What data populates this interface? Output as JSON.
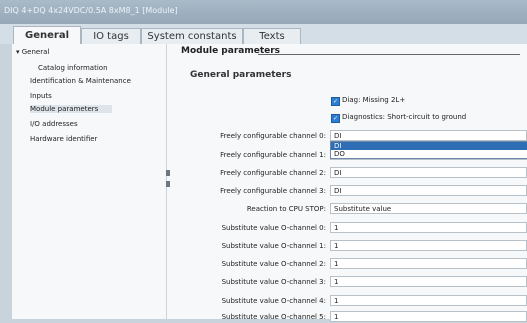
{
  "window": {
    "title": "DIQ 4+DQ 4x24VDC/0.5A 8xM8_1 [Module]"
  },
  "tabs": [
    {
      "label": "General",
      "active": true
    },
    {
      "label": "IO tags",
      "active": false
    },
    {
      "label": "System constants",
      "active": false
    },
    {
      "label": "Texts",
      "active": false
    }
  ],
  "nav": {
    "general": "▾ General",
    "catalog": "Catalog information",
    "identification": "Identification & Maintenance",
    "inputs": "Inputs",
    "module_parameters": "Module parameters",
    "io_addresses": "I/O addresses",
    "hardware_identifier": "Hardware identifier"
  },
  "main": {
    "section_title": "Module parameters",
    "subsection_title": "General parameters",
    "checks": [
      {
        "label": "Diag: Missing 2L+",
        "checked": true
      },
      {
        "label": "Diagnostics: Short-circuit to ground",
        "checked": true
      }
    ],
    "rows": [
      {
        "label": "Freely configurable channel 0:",
        "value": "DI"
      },
      {
        "label": "Freely configurable channel 1:",
        "value": "DO"
      },
      {
        "label": "Freely configurable channel 2:",
        "value": "DI"
      },
      {
        "label": "Freely configurable channel 3:",
        "value": "DI"
      },
      {
        "label": "Reaction to CPU STOP:",
        "value": "Substitute value"
      },
      {
        "label": "Substitute value O-channel 0:",
        "value": "1"
      },
      {
        "label": "Substitute value O-channel 1:",
        "value": "1"
      },
      {
        "label": "Substitute value O-channel 2:",
        "value": "1"
      },
      {
        "label": "Substitute value O-channel 3:",
        "value": "1"
      },
      {
        "label": "Substitute value O-channel 4:",
        "value": "1"
      },
      {
        "label": "Substitute value O-channel 5:",
        "value": "1"
      }
    ],
    "dropdown_options": [
      {
        "label": "DI",
        "selected": true
      },
      {
        "label": "DO",
        "selected": false
      }
    ]
  },
  "colors": {
    "accent": "#2f6db5",
    "titlebar": "#9fb2c2",
    "panel": "#f7f8f9"
  }
}
